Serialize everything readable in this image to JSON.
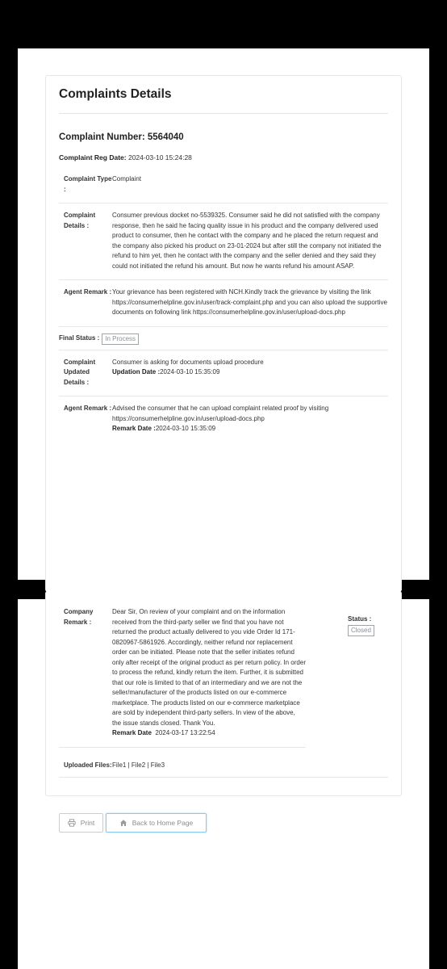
{
  "page1": {
    "title": "Complaints Details",
    "complaint_number": "Complaint Number: 5564040",
    "reg_date_label": "Complaint Reg Date:",
    "reg_date_value": "2024-03-10 15:24:28",
    "complaint_type_label": "Complaint Type :",
    "complaint_type_value": "Complaint",
    "complaint_details_label": "Complaint Details :",
    "complaint_details_value": "Consumer previous docket no-5539325. Consumer said he did not satisfied with the company response, then he said he facing quality issue in his product and the company delivered used product to consumer, then he contact with the company and he placed the return request and the company also picked his product on 23-01-2024 but after still the company not initiated the refund to him yet, then he contact with the company and the seller denied and they said they could not initiated the refund his amount. But now he wants refund his amount ASAP.",
    "agent_remark_label": "Agent Remark :",
    "agent_remark_value": "Your grievance has been registered with NCH.Kindly track the grievance by visiting the link https://consumerhelpline.gov.in/user/track-complaint.php and you can also upload the supportive documents on following link https://consumerhelpline.gov.in/user/upload-docs.php",
    "final_status_label": "Final Status :",
    "final_status_value": "In Process",
    "updated_details_label": "Complaint Updated Details :",
    "updated_details_value": "Consumer is asking for documents upload procedure",
    "updation_date_label": "Updation Date :",
    "updation_date_value": "2024-03-10 15:35:09",
    "agent_remark2_label": "Agent Remark :",
    "agent_remark2_value": "Advised the consumer that he can upload complaint related proof by visiting https://consumerhelpline.gov.in/user/upload-docs.php",
    "remark_date_label": "Remark Date :",
    "remark_date_value": "2024-03-10 15:35:09"
  },
  "page2": {
    "company_remark_label": "Company Remark :",
    "company_remark_value": "Dear Sir, On review of your complaint and on the information received from the third-party seller we find that you have not returned the product actually delivered to you vide Order Id 171-0820967-5861926. Accordingly, neither refund nor replacement order can be initiated. Please note that the seller initiates refund only after receipt of the original product as per return policy. In order to process the refund, kindly return the item. Further, it is submitted that our role is limited to that of an intermediary and we are not the seller/manufacturer of the products listed on our e-commerce marketplace. The products listed on our e-commerce marketplace are sold by independent third-party sellers. In view of the above, the issue stands closed. Thank You.",
    "remark_date_label": "Remark Date",
    "remark_date_value": "2024-03-17 13:22:54",
    "status_label": "Status :",
    "status_value": "Closed",
    "uploaded_files_label": "Uploaded Files:",
    "uploaded_files_value": "File1 | File2 | File3",
    "print_label": "Print",
    "home_label": "Back to Home Page"
  },
  "icons": {
    "print": "printer-icon",
    "home": "home-icon"
  }
}
